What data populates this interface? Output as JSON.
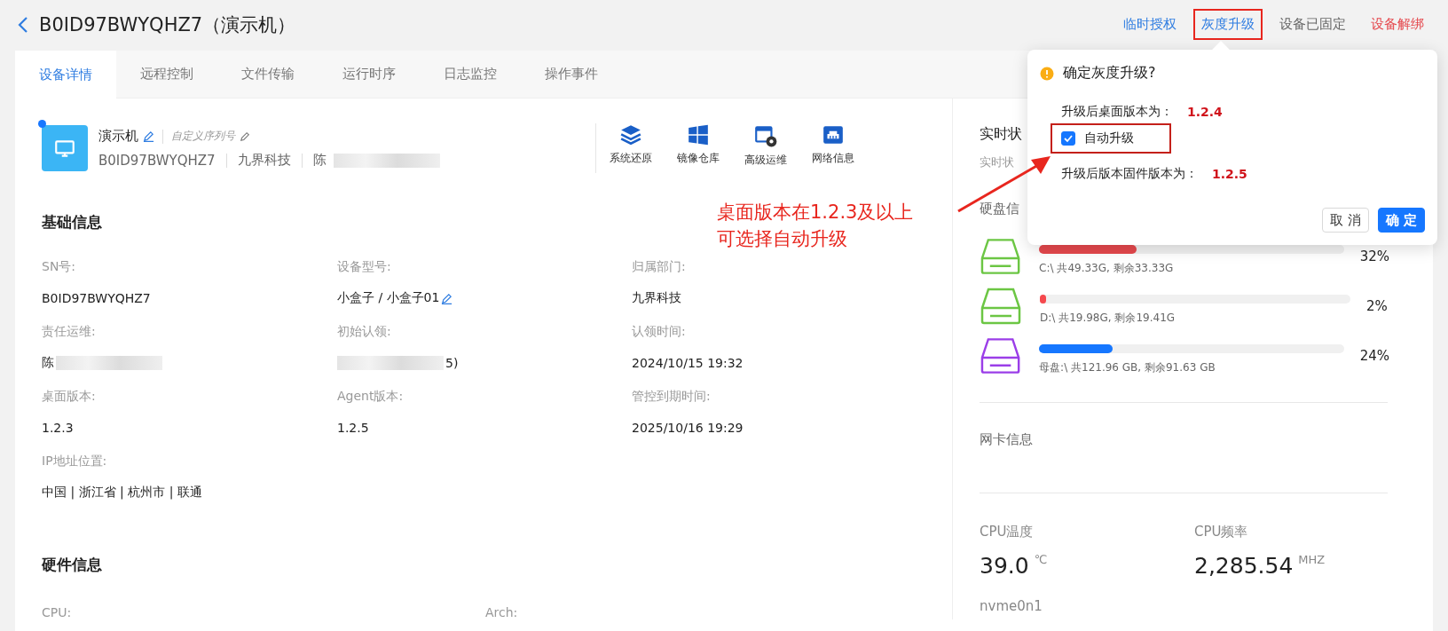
{
  "header": {
    "title": "B0ID97BWYQHZ7（演示机）",
    "actions": [
      {
        "label": "临时授权",
        "kind": "link",
        "annotated": false
      },
      {
        "label": "灰度升级",
        "kind": "link",
        "annotated": true
      },
      {
        "label": "设备已固定",
        "kind": "muted",
        "annotated": false
      },
      {
        "label": "设备解绑",
        "kind": "danger",
        "annotated": false
      }
    ]
  },
  "tabs": [
    {
      "label": "设备详情",
      "selected": true
    },
    {
      "label": "远程控制",
      "selected": false
    },
    {
      "label": "文件传输",
      "selected": false
    },
    {
      "label": "运行时序",
      "selected": false
    },
    {
      "label": "日志监控",
      "selected": false
    },
    {
      "label": "操作事件",
      "selected": false
    }
  ],
  "device": {
    "online": true,
    "name": "演示机",
    "custom_serial_placeholder": "自定义序列号",
    "sn": "B0ID97BWYQHZ7",
    "company": "九界科技",
    "owner": "陈",
    "tools": [
      {
        "label": "系统还原",
        "kind": "layers"
      },
      {
        "label": "镜像仓库",
        "kind": "windows"
      },
      {
        "label": "高级运维",
        "kind": "gear-window"
      },
      {
        "label": "网络信息",
        "kind": "network"
      }
    ]
  },
  "basic_info": {
    "title": "基础信息",
    "fields": [
      {
        "label": "SN号:",
        "value": "B0ID97BWYQHZ7"
      },
      {
        "label": "设备型号:",
        "value": "小盒子  / 小盒子01",
        "editable": true
      },
      {
        "label": "归属部门:",
        "value": "九界科技"
      },
      {
        "label": "责任运维:",
        "value": "陈",
        "redacted": true
      },
      {
        "label": "初始认领:",
        "value": "5)",
        "redacted": true
      },
      {
        "label": "认领时间:",
        "value": "2024/10/15 19:32"
      },
      {
        "label": "桌面版本:",
        "value": "1.2.3"
      },
      {
        "label": "Agent版本:",
        "value": "1.2.5"
      },
      {
        "label": "管控到期时间:",
        "value": "2025/10/16 19:29"
      },
      {
        "label": "IP地址位置:",
        "value": "中国 | 浙江省 | 杭州市 | 联通"
      }
    ]
  },
  "hardware_info": {
    "title": "硬件信息",
    "fields": [
      {
        "label": "CPU:"
      },
      {
        "label": "Arch:"
      }
    ]
  },
  "realtime": {
    "title": "实时状",
    "subtitle": "实时状",
    "disk_title": "硬盘信",
    "disks": [
      {
        "label": "C:\\ 共49.33G, 剩余33.33G",
        "percent": "32%",
        "level": 0.32,
        "color": "#e5484d",
        "kind": "partition"
      },
      {
        "label": "D:\\ 共19.98G, 剩余19.41G",
        "percent": "2%",
        "level": 0.02,
        "color": "#f5484d",
        "kind": "partition"
      },
      {
        "label": "母盘:\\ 共121.96 GB, 剩余91.63 GB",
        "percent": "24%",
        "level": 0.24,
        "color": "#1677ff",
        "kind": "master"
      }
    ],
    "nic_title": "网卡信息",
    "metrics": [
      {
        "label": "CPU温度",
        "value": "39.0",
        "unit": "℃"
      },
      {
        "label": "CPU频率",
        "value": "2,285.54",
        "unit": "MHZ"
      }
    ],
    "disk_name": "nvme0n1"
  },
  "popconfirm": {
    "title": "确定灰度升级?",
    "rows": [
      {
        "kind": "text",
        "label": "升级后桌面版本为：",
        "value": "1.2.4"
      },
      {
        "kind": "checkbox",
        "label": "自动升级",
        "checked": true,
        "annotated": true
      },
      {
        "kind": "text",
        "label": "升级后版本固件版本为：",
        "value": "1.2.5"
      }
    ],
    "cancel": "取 消",
    "ok": "确 定"
  },
  "annotation": {
    "lines": [
      "桌面版本在1.2.3及以上",
      "可选择自动升级"
    ]
  }
}
